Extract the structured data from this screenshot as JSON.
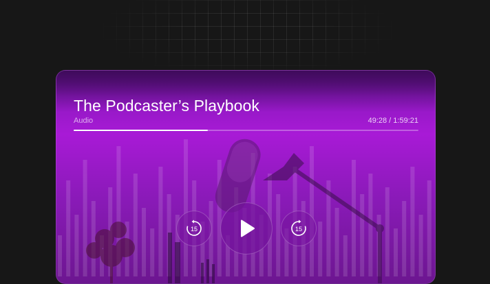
{
  "player": {
    "title": "The Podcaster’s Playbook",
    "subtitle": "Audio",
    "time_display": "49:28 / 1:59:21",
    "progress_fraction": 0.39,
    "rewind_seconds": "15",
    "forward_seconds": "15"
  },
  "colors": {
    "page_background": "#171717",
    "card_gradient_top": "#8e18c0",
    "card_gradient_mid": "#a81ad6",
    "accent_white": "#ffffff"
  },
  "icons": {
    "rewind": "rewind-15-icon",
    "play": "play-icon",
    "forward": "forward-15-icon"
  }
}
